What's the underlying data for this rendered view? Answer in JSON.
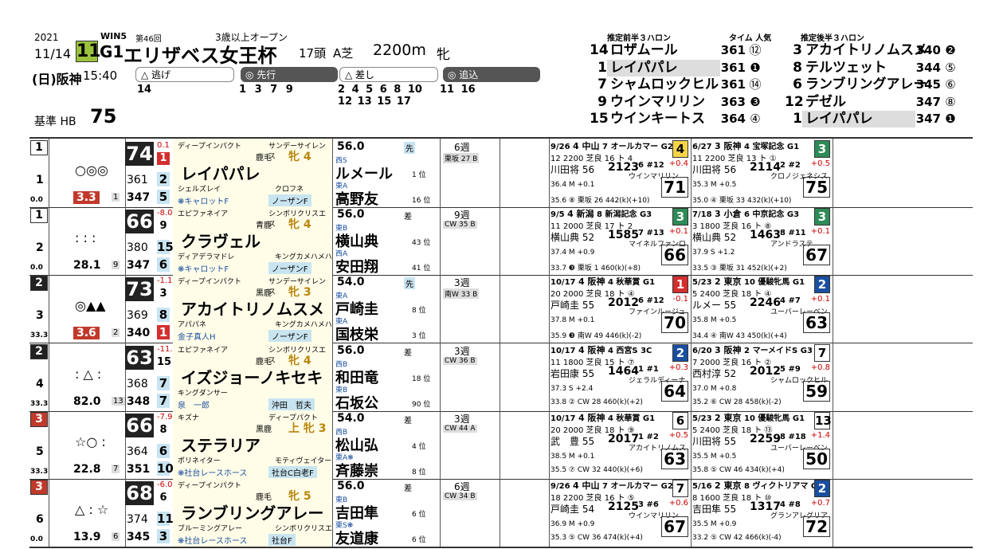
{
  "header": {
    "year": "2021",
    "date": "11/14",
    "race_no": "11",
    "grade": "G1",
    "win5": "WIN5",
    "edition": "第46回",
    "race_name": "エリザベス女王杯",
    "class": "3歳以上オープン",
    "venue": "(日)阪神",
    "post_time": "15:40",
    "field": "17頭",
    "course": "A芝",
    "distance": "2200m",
    "sex": "牝",
    "base_hb_label": "基準 HB",
    "base_hb": "75"
  },
  "styles": {
    "nige": {
      "label": "逃げ",
      "nums": "14"
    },
    "senko": {
      "label": "先行",
      "nums": "1 3 7 9"
    },
    "sashi": {
      "label": "差し",
      "nums": "2 4 5 6 8 10",
      "nums2": "12 13 15 17"
    },
    "oikomi": {
      "label": "追込",
      "nums": "11 16"
    }
  },
  "laps": {
    "front_title": "推定前半３ハロン",
    "time_title": "タイム 人気",
    "back_title": "推定後半３ハロン",
    "front": [
      {
        "no": "14",
        "name": "ロザムール",
        "time": "361",
        "pop": "⑫",
        "hl": false
      },
      {
        "no": "1",
        "name": "レイパパレ",
        "time": "361",
        "pop": "❶",
        "hl": true
      },
      {
        "no": "7",
        "name": "シャムロックヒル",
        "time": "361",
        "pop": "⑭",
        "hl": false
      },
      {
        "no": "9",
        "name": "ウインマリリン",
        "time": "363",
        "pop": "❸",
        "hl": false
      },
      {
        "no": "15",
        "name": "ウインキートス",
        "time": "364",
        "pop": "④",
        "hl": false
      }
    ],
    "back": [
      {
        "no": "3",
        "name": "アカイトリノムスメ",
        "time": "340",
        "pop": "❷",
        "hl": false
      },
      {
        "no": "8",
        "name": "テルツェット",
        "time": "344",
        "pop": "⑤",
        "hl": false
      },
      {
        "no": "6",
        "name": "ランブリングアレー",
        "time": "345",
        "pop": "⑥",
        "hl": false
      },
      {
        "no": "12",
        "name": "デゼル",
        "time": "347",
        "pop": "⑧",
        "hl": false
      },
      {
        "no": "1",
        "name": "レイパパレ",
        "time": "347",
        "pop": "❶",
        "hl": true
      }
    ]
  },
  "colors": {
    "frame1": "#ffffff",
    "frame2": "#222222",
    "frame3": "#c0392b",
    "green": "#2e8b57",
    "red": "#d32f2f",
    "blue": "#1a4fa0",
    "yellow": "#f5d547"
  },
  "horses": [
    {
      "frame": "1",
      "frame_color": "#ffffff",
      "frame_text": "#000000",
      "no": "1",
      "marks": "○◎◎",
      "odds": "3.3",
      "pop": "1",
      "ratio": "0.0",
      "idx": "74",
      "idx_diff": "0.1",
      "idx_rank": "1",
      "sub1": "361",
      "rank1": "2",
      "sub2": "347",
      "rank2": "5",
      "sire": "ディープインパクト",
      "dam_sire": "サンデーサイレンス",
      "coat": "鹿毛",
      "sex_age": "牝 4",
      "name": "レイパパレ",
      "dam": "シェルズレイ",
      "dam_dam": "クロフネ",
      "owner": "❋キャロットF",
      "breeder": "ノーザンF",
      "weight": "56.0",
      "style": "先",
      "center": "西S",
      "jockey": "ルメール",
      "jockey_rank": "1 位",
      "trainer_mark": "東A",
      "trainer": "高野友",
      "trainer_rank": "16 位",
      "interval": "6週",
      "train": "栗坂 27 B",
      "r1": {
        "date": "9/26",
        "place": "4 中山",
        "day": "7",
        "race": "オールカマー",
        "grade": "G2",
        "rank": "4",
        "rank_bg": "#f5d547",
        "detail": "12 2200 芝良 16 ト 4",
        "jockey": "川田将 56",
        "time": "2123",
        "pos": "6 #12",
        "diff": "+0.4",
        "winner": "ウインマリリン",
        "idx": "71",
        "pace": "36.4 M +0.1",
        "bottom": "35.6 ⑧ 栗坂 26 442(k)(+10)"
      },
      "r2": {
        "date": "6/27",
        "place": "3 阪神",
        "day": "4",
        "race": "宝塚記念",
        "grade": "G1",
        "rank": "3",
        "rank_bg": "#2e8b57",
        "detail": "11 2200 芝良 13 ト ①",
        "jockey": "川田将 56",
        "time": "2114",
        "pos": "2 #2",
        "diff": "+0.5",
        "winner": "クロノジェネシス",
        "idx": "75",
        "pace": "35.3 M +0.5",
        "bottom": "35.0 ④ 栗坂 33 432(k)(+10)"
      }
    },
    {
      "frame": "1",
      "frame_color": "#ffffff",
      "frame_text": "#000000",
      "no": "2",
      "marks": ": : :",
      "odds": "28.1",
      "pop": "9",
      "ratio": "0.0",
      "idx": "66",
      "idx_diff": "-8.0",
      "idx_rank": "9",
      "sub1": "380",
      "rank1": "15",
      "sub2": "347",
      "rank2": "6",
      "sire": "エピファネイア",
      "dam_sire": "シンボリクリスエス",
      "coat": "青鹿",
      "sex_age": "牝 4",
      "name": "クラヴェル",
      "dam": "ディアデラマドレ",
      "dam_dam": "キングカメハメハ",
      "owner": "❋キャロットF",
      "breeder": "ノーザンF",
      "weight": "56.0",
      "style": "差",
      "center": "東B",
      "jockey": "横山典",
      "jockey_rank": "43 位",
      "trainer_mark": "西A",
      "trainer": "安田翔",
      "trainer_rank": "41 位",
      "interval": "9週",
      "train": "CW 35 B",
      "r1": {
        "date": "9/5",
        "place": "4 新潟",
        "day": "8",
        "race": "新潟記念",
        "grade": "G3",
        "rank": "3",
        "rank_bg": "#2e8b57",
        "detail": "11 2000 芝良 17 ト 2",
        "jockey": "横山典 52",
        "time": "1585",
        "pos": "7 #13",
        "diff": "+0.1",
        "winner": "マイネルファンロ",
        "idx": "66",
        "pace": "37.4 M +0.9",
        "bottom": "33.7 ❸ 栗坂 1 460(k)(+8)"
      },
      "r2": {
        "date": "7/18",
        "place": "3 小倉",
        "day": "6",
        "race": "中京記念",
        "grade": "G3",
        "rank": "3",
        "rank_bg": "#2e8b57",
        "detail": "3 1800 芝良 16 ト ⑧",
        "jockey": "横山典 52",
        "time": "1463",
        "pos": "8 #11",
        "diff": "+0.1",
        "winner": "アンドラステ",
        "idx": "67",
        "pace": "37.9 S +1.2",
        "bottom": "33.5 ③ 栗坂 31 452(k)(+2)"
      }
    },
    {
      "frame": "2",
      "frame_color": "#222222",
      "frame_text": "#ffffff",
      "no": "3",
      "marks": "◎▲▲",
      "odds": "3.6",
      "pop": "2",
      "ratio": "33.3",
      "idx": "73",
      "idx_diff": "-1.1",
      "idx_rank": "3",
      "sub1": "369",
      "rank1": "8",
      "sub2": "340",
      "rank2": "1",
      "sire": "ディープインパクト",
      "dam_sire": "サンデーサイレンス",
      "coat": "黒鹿",
      "sex_age": "牝 3",
      "name": "アカイトリノムスメ",
      "dam": "アパパネ",
      "dam_dam": "キングカメハメハ",
      "owner": "金子真人H",
      "breeder": "ノーザンF",
      "weight": "54.0",
      "style": "先",
      "center": "東A",
      "jockey": "戸崎圭",
      "jockey_rank": "8 位",
      "trainer_mark": "東A",
      "trainer": "国枝栄",
      "trainer_rank": "3 位",
      "interval": "3週",
      "train": "南W 33 B",
      "r1": {
        "date": "10/17",
        "place": "4 阪神",
        "day": "4",
        "race": "秋華賞",
        "grade": "G1",
        "rank": "1",
        "rank_bg": "#d32f2f",
        "detail": "20 2000 芝良 18 ト ④",
        "jockey": "戸崎圭 55",
        "time": "2012",
        "pos": "6 #12",
        "diff": "-0.1",
        "winner": "ファインルージュ",
        "idx": "70",
        "pace": "37.8 M +0.1",
        "bottom": "35.9 ❸ 南W 49 446(k)(-2)"
      },
      "r2": {
        "date": "5/23",
        "place": "2 東京",
        "day": "10",
        "race": "優駿牝馬",
        "grade": "G1",
        "rank": "2",
        "rank_bg": "#1a4fa0",
        "detail": "5 2400 芝良 18 ト ④",
        "jockey": "ルメー 55",
        "time": "2246",
        "pos": "4 #7",
        "diff": "+0.1",
        "winner": "ユーバーレーベン",
        "idx": "63",
        "pace": "35.8 M +0.5",
        "bottom": "34.4 ④ 南W 43 450(k)(+4)"
      }
    },
    {
      "frame": "2",
      "frame_color": "#222222",
      "frame_text": "#ffffff",
      "no": "4",
      "marks": ": △ :",
      "odds": "82.0",
      "pop": "13",
      "ratio": "33.3",
      "idx": "63",
      "idx_diff": "-11.1",
      "idx_rank": "15",
      "sub1": "368",
      "rank1": "7",
      "sub2": "348",
      "rank2": "7",
      "sire": "エピファネイア",
      "dam_sire": "シンボリクリスエス",
      "coat": "鹿毛",
      "sex_age": "牝 4",
      "name": "イズジョーノキセキ",
      "dam": "キングダンサー",
      "dam_dam": "",
      "owner": "泉　一郎",
      "breeder": "沖田　哲夫",
      "weight": "56.0",
      "style": "差",
      "center": "西B",
      "jockey": "和田竜",
      "jockey_rank": "18 位",
      "trainer_mark": "東B",
      "trainer": "石坂公",
      "trainer_rank": "90 位",
      "interval": "3週",
      "train": "CW 36 B",
      "r1": {
        "date": "10/17",
        "place": "4 阪神",
        "day": "4",
        "race": "西宮S",
        "grade": "3C",
        "rank": "2",
        "rank_bg": "#1a4fa0",
        "detail": "11 1800 芝良 15 ト ⑦",
        "jockey": "岩田康 55",
        "time": "1464",
        "pos": "1 #1",
        "diff": "+0.3",
        "winner": "ジェラルディーナ",
        "idx": "64",
        "pace": "37.3 S +2.4",
        "bottom": "33.8 ② CW 28 460(k)(+2)"
      },
      "r2": {
        "date": "6/20",
        "place": "3 阪神",
        "day": "2",
        "race": "マーメイドS",
        "grade": "G3",
        "rank": "7",
        "rank_bg": "#ffffff",
        "detail": "7 2000 芝良 16 ト ②",
        "jockey": "西村淳 52",
        "time": "2012",
        "pos": "5 #9",
        "diff": "+0.8",
        "winner": "シャムロックヒル",
        "idx": "59",
        "pace": "37.0 M +0.8",
        "bottom": "35.2 ⑥ CW 28 458(k)(-2)"
      }
    },
    {
      "frame": "3",
      "frame_color": "#c0392b",
      "frame_text": "#ffffff",
      "no": "5",
      "marks": "☆○ :",
      "odds": "22.8",
      "pop": "7",
      "ratio": "33.3",
      "idx": "66",
      "idx_diff": "-7.9",
      "idx_rank": "8",
      "sub1": "364",
      "rank1": "6",
      "sub2": "351",
      "rank2": "10",
      "sire": "キズナ",
      "dam_sire": "ディープパクト",
      "coat": "黒鹿",
      "sex_age": "上 牝 3",
      "name": "ステラリア",
      "dam": "ポリネイター",
      "dam_dam": "モティヴェイター",
      "owner": "❋社台レースホース",
      "breeder": "社台C白老F",
      "weight": "54.0",
      "style": "差",
      "center": "西B",
      "jockey": "松山弘",
      "jockey_rank": "4 位",
      "trainer_mark": "栗A❋",
      "trainer": "斉藤崇",
      "trainer_rank": "8 位",
      "interval": "3週",
      "train": "CW 44 A",
      "r1": {
        "date": "10/17",
        "place": "4 阪神",
        "day": "4",
        "race": "秋華賞",
        "grade": "G1",
        "rank": "6",
        "rank_bg": "#ffffff",
        "detail": "20 2000 芝良 18 ト ⑨",
        "jockey": "武　豊 55",
        "time": "2017",
        "pos": "1 #2",
        "diff": "+0.5",
        "winner": "アカイトリノムス",
        "idx": "63",
        "pace": "38.5 M +0.1",
        "bottom": "35.5 ⑦ CW 32 440(k)(+6)"
      },
      "r2": {
        "date": "5/23",
        "place": "2 東京",
        "day": "10",
        "race": "優駿牝馬",
        "grade": "G1",
        "rank": "13",
        "rank_bg": "#ffffff",
        "detail": "5 2400 芝良 18 ト ⑬",
        "jockey": "川田将 55",
        "time": "2259",
        "pos": "8 #18",
        "diff": "+1.4",
        "winner": "ユーバーレーベン",
        "idx": "50",
        "pace": "35.5 M +0.5",
        "bottom": "35.8 ⑤ CW 46 434(k)(+4)"
      }
    },
    {
      "frame": "3",
      "frame_color": "#c0392b",
      "frame_text": "#ffffff",
      "no": "6",
      "marks": "△ : ☆",
      "odds": "13.9",
      "pop": "6",
      "ratio": "0.0",
      "idx": "68",
      "idx_diff": "-6.0",
      "idx_rank": "6",
      "sub1": "374",
      "rank1": "11",
      "sub2": "345",
      "rank2": "3",
      "sire": "ディープインパクト",
      "dam_sire": "",
      "coat": "鹿毛",
      "sex_age": "牝 5",
      "name": "ランブリングアレー",
      "dam": "ブルーミングアレー",
      "dam_dam": "シンボリクリスエス",
      "owner": "❋社台レースホース",
      "breeder": "社台F",
      "weight": "56.0",
      "style": "差",
      "center": "東B",
      "jockey": "吉田隼",
      "jockey_rank": "6 位",
      "trainer_mark": "栗S❋",
      "trainer": "友道康",
      "trainer_rank": "6 位",
      "interval": "6週",
      "train": "CW 34 B",
      "r1": {
        "date": "9/26",
        "place": "4 中山",
        "day": "7",
        "race": "オールカマー",
        "grade": "G2",
        "rank": "7",
        "rank_bg": "#ffffff",
        "detail": "18 2200 芝良 16 ト ⑤",
        "jockey": "戸崎圭 54",
        "time": "2125",
        "pos": "3 #6",
        "diff": "+0.6",
        "winner": "ウインマリリン",
        "idx": "67",
        "pace": "36.9 M +0.9",
        "bottom": "35.3 ⑤ CW 36 474(k)(+4)"
      },
      "r2": {
        "date": "5/16",
        "place": "2 東京",
        "day": "8",
        "race": "ヴィクトリアマ",
        "grade": "G1",
        "rank": "2",
        "rank_bg": "#1a4fa0",
        "detail": "8 1600 芝良 18 ト ⑩",
        "jockey": "吉田隼 55",
        "time": "1317",
        "pos": "4 #8",
        "diff": "+0.7",
        "winner": "グランアレグリア",
        "idx": "72",
        "pace": "35.5 M +0.9",
        "bottom": "33.2 ⑤ CW 42 466(k)(-4)"
      }
    }
  ]
}
